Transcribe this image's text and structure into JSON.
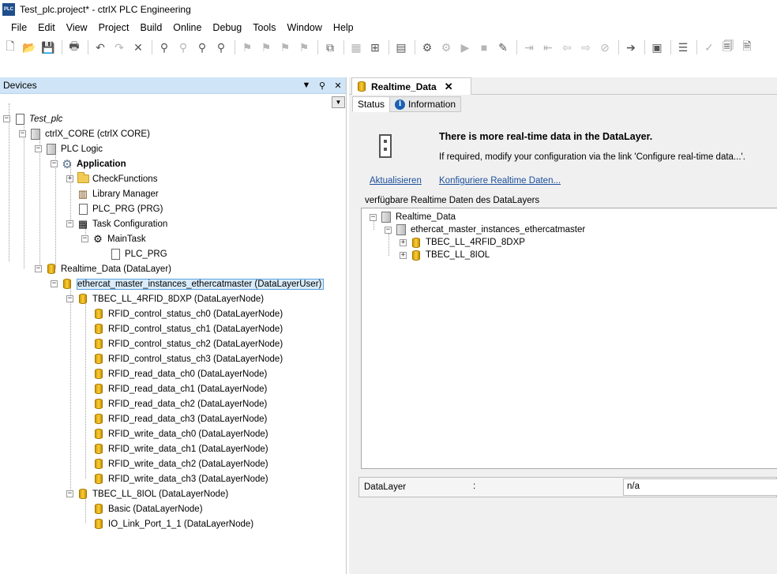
{
  "window": {
    "logo_text": "PLC",
    "title": "Test_plc.project* - ctrlX PLC Engineering"
  },
  "menu": [
    "File",
    "Edit",
    "View",
    "Project",
    "Build",
    "Online",
    "Debug",
    "Tools",
    "Window",
    "Help"
  ],
  "devices_panel": {
    "title": "Devices",
    "tree": [
      {
        "label": "Test_plc",
        "italic": true
      },
      {
        "label": "ctrlX_CORE (ctrlX CORE)"
      },
      {
        "label": "PLC Logic"
      },
      {
        "label": "Application",
        "bold": true
      },
      {
        "label": "CheckFunctions"
      },
      {
        "label": "Library Manager"
      },
      {
        "label": "PLC_PRG (PRG)"
      },
      {
        "label": "Task Configuration"
      },
      {
        "label": "MainTask"
      },
      {
        "label": "PLC_PRG"
      },
      {
        "label": "Realtime_Data (DataLayer)"
      },
      {
        "label": "ethercat_master_instances_ethercatmaster (DataLayerUser)",
        "selected": true
      },
      {
        "label": "TBEC_LL_4RFID_8DXP (DataLayerNode)"
      },
      {
        "label": "RFID_control_status_ch0 (DataLayerNode)"
      },
      {
        "label": "RFID_control_status_ch1 (DataLayerNode)"
      },
      {
        "label": "RFID_control_status_ch2 (DataLayerNode)"
      },
      {
        "label": "RFID_control_status_ch3 (DataLayerNode)"
      },
      {
        "label": "RFID_read_data_ch0 (DataLayerNode)"
      },
      {
        "label": "RFID_read_data_ch1 (DataLayerNode)"
      },
      {
        "label": "RFID_read_data_ch2 (DataLayerNode)"
      },
      {
        "label": "RFID_read_data_ch3 (DataLayerNode)"
      },
      {
        "label": "RFID_write_data_ch0 (DataLayerNode)"
      },
      {
        "label": "RFID_write_data_ch1 (DataLayerNode)"
      },
      {
        "label": "RFID_write_data_ch2 (DataLayerNode)"
      },
      {
        "label": "RFID_write_data_ch3 (DataLayerNode)"
      },
      {
        "label": "TBEC_LL_8IOL (DataLayerNode)"
      },
      {
        "label": "Basic (DataLayerNode)"
      },
      {
        "label": "IO_Link_Port_1_1 (DataLayerNode)"
      }
    ]
  },
  "realtime_panel": {
    "tab_title": "Realtime_Data",
    "subtabs": [
      "Status",
      "Information"
    ],
    "message_title": "There is more real-time data in the DataLayer.",
    "message_body": "If required, modify your configuration via the link 'Configure real-time data...'.",
    "link_refresh": "Aktualisieren",
    "link_configure": "Konfiguriere Realtime Daten...",
    "group_title": "verfügbare Realtime Daten des DataLayers",
    "group_tree": [
      "Realtime_Data",
      "ethercat_master_instances_ethercatmaster",
      "TBEC_LL_4RFID_8DXP",
      "TBEC_LL_8IOL"
    ],
    "field_label": "DataLayer",
    "field_colon": ":",
    "field_value": "n/a"
  }
}
